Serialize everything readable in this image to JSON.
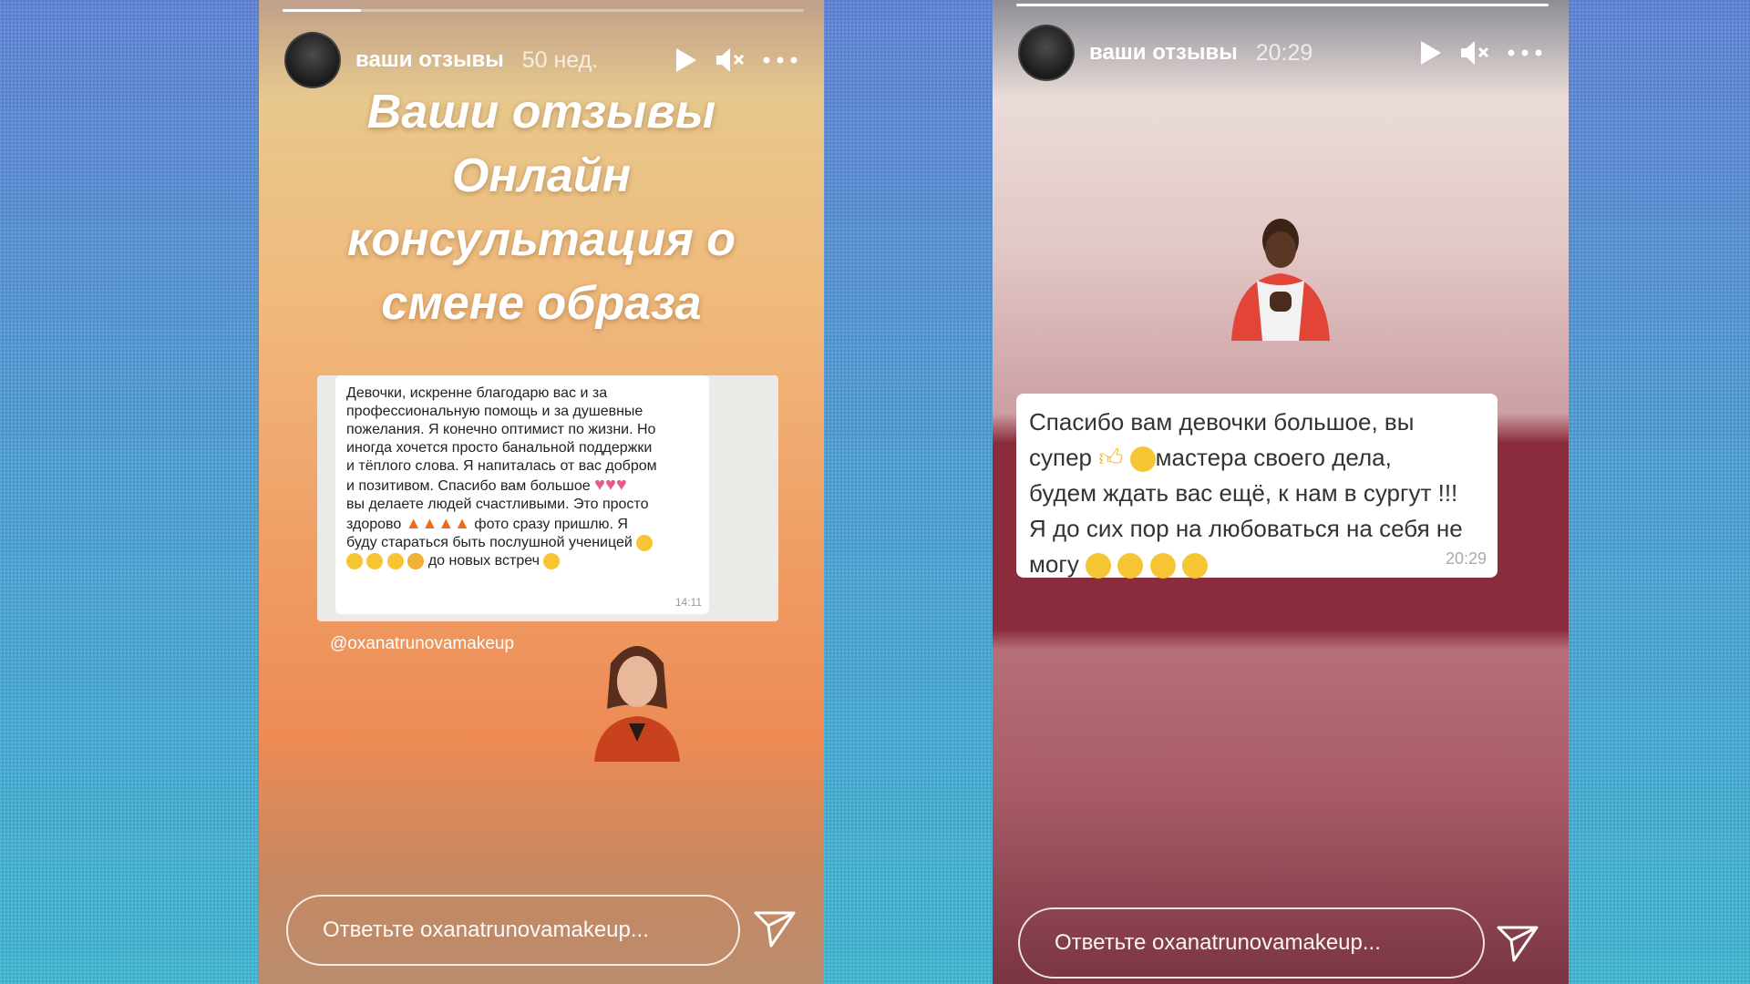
{
  "colors": {
    "accent_white": "#ffffff",
    "chat_bg": "#eceae6",
    "maroon_band": "#8a2c3b"
  },
  "icons": [
    "play-icon",
    "mute-icon",
    "more-icon",
    "send-icon"
  ],
  "story1": {
    "progress": 0.15,
    "username": "ваши отзывы",
    "time": "50 нед.",
    "title": [
      "Ваши отзывы",
      "Онлайн",
      "консультация о",
      "смене образа"
    ],
    "chat": {
      "lines": [
        "Девочки, искренне благодарю вас и за",
        "профессиональную помощь и за душевные",
        "пожелания. Я конечно оптимист по жизни. Но",
        "иногда хочется просто банальной поддержки",
        "и тёплого слова. Я напиталась от вас добром",
        "и позитивом. Спасибо вам большое",
        "вы делаете людей счастливыми. Это просто",
        "здорово",
        "фото сразу пришлю. Я",
        "буду стараться быть послушной ученицей",
        "до новых встреч"
      ],
      "time": "14:11"
    },
    "mention": "@oxanatrunovamakeup",
    "reply_placeholder": "Ответьте oxanatrunovamakeup..."
  },
  "story2": {
    "progress": 1.0,
    "username": "ваши отзывы",
    "time": "20:29",
    "message": {
      "part1": "Спасибо вам девочки большое, вы",
      "part2": "супер",
      "part3": "мастера своего дела,",
      "part4": "будем ждать вас ещё, к нам в сургут !!!",
      "part5": "Я до сих пор на любоваться на себя не",
      "part6": "могу"
    },
    "reply_placeholder": "Ответьте oxanatrunovamakeup..."
  }
}
